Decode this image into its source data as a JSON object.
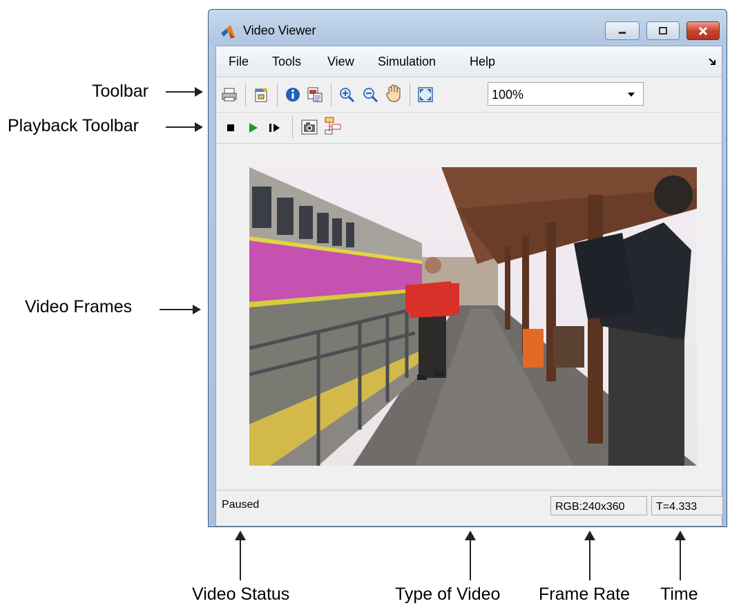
{
  "window": {
    "title": "Video Viewer",
    "menu": [
      "File",
      "Tools",
      "View",
      "Simulation",
      "Help"
    ]
  },
  "toolbar": {
    "icons": [
      "print-icon",
      "new-window-icon",
      "info-icon",
      "properties-icon",
      "zoom-in-icon",
      "zoom-out-icon",
      "pan-hand-icon",
      "fit-to-view-icon"
    ],
    "zoom_value": "100%"
  },
  "playback": {
    "icons": [
      "stop-icon",
      "play-icon",
      "step-forward-icon",
      "snapshot-icon",
      "highlight-block-icon"
    ]
  },
  "status": {
    "state": "Paused",
    "video_type": "RGB:240x360",
    "time": "T=4.333"
  },
  "annotations": {
    "toolbar": "Toolbar",
    "playback_toolbar": "Playback Toolbar",
    "video_frames": "Video Frames",
    "video_status": "Video Status",
    "type_of_video": "Type of Video",
    "frame_rate": "Frame Rate",
    "time": "Time"
  },
  "colors": {
    "title_gradient": "#b3c9e3",
    "close_button": "#c7452f",
    "play_green": "#1a9c1a"
  }
}
